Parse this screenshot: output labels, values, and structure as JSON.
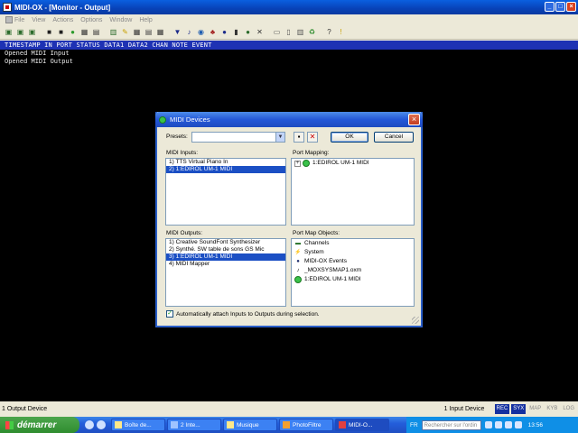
{
  "window": {
    "title": "MIDI-OX - [Monitor - Output]"
  },
  "menubar": {
    "items": [
      "File",
      "View",
      "Actions",
      "Options",
      "Window",
      "Help"
    ]
  },
  "toolbar": {
    "icons": [
      "new-icon",
      "open-icon",
      "save-icon",
      "monitor-input-icon",
      "monitor-output-icon",
      "ports-icon",
      "grid-icon",
      "keyboard-icon",
      "filter-icon",
      "pencil-icon",
      "mapping-icon",
      "sysex-icon",
      "instrument-icon",
      "note-icon",
      "patch-icon",
      "circle-icon",
      "bank-icon",
      "dial-icon",
      "clear-icon",
      "copy-icon",
      "options-icon",
      "reset-icon",
      "panic-icon",
      "help-icon",
      "pin-icon"
    ]
  },
  "monitor": {
    "header": "TIMESTAMP IN PORT STATUS DATA1 DATA2 CHAN NOTE EVENT",
    "lines": [
      "Opened MIDI Input",
      "Opened MIDI Output"
    ]
  },
  "statusbar": {
    "left": "1 Output Device",
    "input_devices": "1 Input Device",
    "tags": [
      {
        "label": "REC",
        "active": true
      },
      {
        "label": "SYX",
        "active": true
      },
      {
        "label": "MAP",
        "active": false
      },
      {
        "label": "KYB",
        "active": false
      },
      {
        "label": "LOG",
        "active": false
      }
    ]
  },
  "dialog": {
    "title": "MIDI Devices",
    "presets_label": "Presets:",
    "presets_value": "",
    "ok_label": "OK",
    "cancel_label": "Cancel",
    "midi_inputs_label": "MIDI Inputs:",
    "midi_inputs": [
      {
        "label": "1)  TTS Virtual Piano In",
        "selected": false
      },
      {
        "label": "2)  1:EDIROL UM-1 MIDI",
        "selected": true
      }
    ],
    "port_mapping_label": "Port Mapping:",
    "port_mapping": [
      {
        "label": "1:EDIROL UM-1 MIDI"
      }
    ],
    "midi_outputs_label": "MIDI Outputs:",
    "midi_outputs": [
      {
        "label": "1)  Creative SoundFont Synthesizer",
        "selected": false
      },
      {
        "label": "2)  Synthé. SW table de sons GS Mic",
        "selected": false
      },
      {
        "label": "3)  1:EDIROL UM-1 MIDI",
        "selected": true
      },
      {
        "label": "4)  MIDI Mapper",
        "selected": false
      }
    ],
    "port_map_objects_label": "Port Map Objects:",
    "port_map_objects": [
      {
        "label": "Channels",
        "icon": "channels-icon"
      },
      {
        "label": "System",
        "icon": "system-icon"
      },
      {
        "label": "MIDI-OX Events",
        "icon": "events-icon"
      },
      {
        "label": "_MOXSYSMAP1.oxm",
        "icon": "map-file-icon"
      },
      {
        "label": "1:EDIROL UM-1 MIDI",
        "icon": "port-icon"
      }
    ],
    "auto_attach_label": "Automatically attach Inputs to Outputs during selection.",
    "auto_attach_checked": true
  },
  "taskbar": {
    "start_label": "démarrer",
    "tasks": [
      {
        "label": "Boîte de...",
        "active": false
      },
      {
        "label": "2 Inte...",
        "active": false
      },
      {
        "label": "Musique",
        "active": false
      },
      {
        "label": "PhotoFiltre",
        "active": false
      },
      {
        "label": "MIDI-O...",
        "active": true
      }
    ],
    "language": "FR",
    "search_placeholder": "Rechercher sur l'ordin",
    "clock": "13:56"
  }
}
